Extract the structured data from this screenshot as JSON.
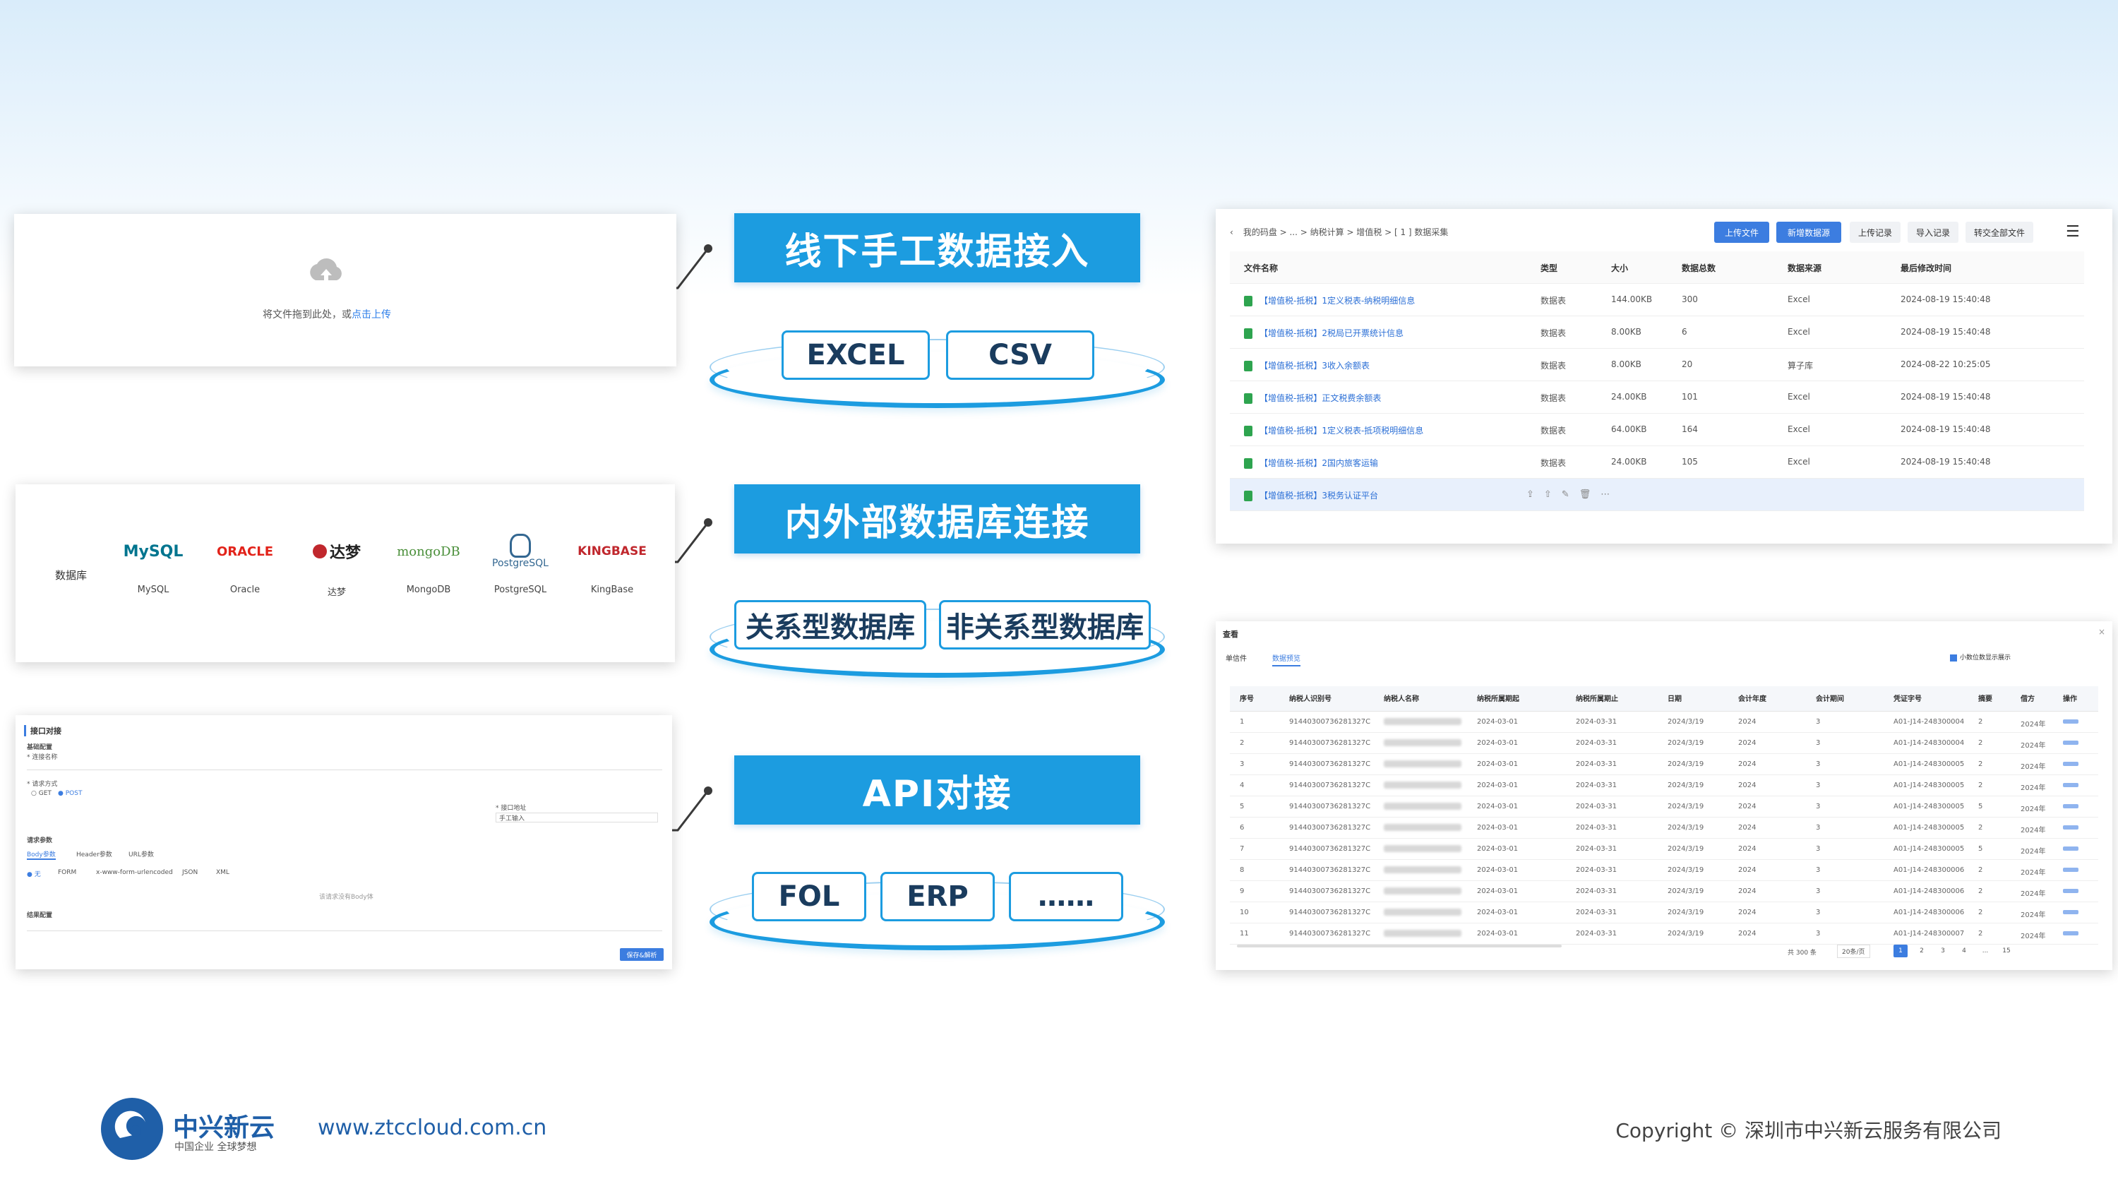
{
  "categories": [
    {
      "title": "线下手工数据接入",
      "tags": [
        "EXCEL",
        "CSV"
      ]
    },
    {
      "title": "内外部数据库连接",
      "tags": [
        "关系型数据库",
        "非关系型数据库"
      ]
    },
    {
      "title": "API对接",
      "tags": [
        "FOL",
        "ERP",
        "……"
      ]
    }
  ],
  "upload_panel": {
    "text": "将文件拖到此处，或",
    "link": "点击上传"
  },
  "db_panel": {
    "label": "数据库",
    "databases": [
      {
        "logo": "MySQL",
        "caption": "MySQL"
      },
      {
        "logo": "ORACLE",
        "caption": "Oracle"
      },
      {
        "logo": "达梦",
        "caption": "达梦"
      },
      {
        "logo": "mongoDB",
        "caption": "MongoDB"
      },
      {
        "logo": "PostgreSQL",
        "caption": "PostgreSQL"
      },
      {
        "logo": "KINGBASE",
        "caption": "KingBase"
      }
    ]
  },
  "api_panel": {
    "title": "接口对接",
    "section_basic": "基础配置",
    "url_label": "* 连接名称",
    "method_label": "* 请求方式",
    "methods": [
      "GET",
      "POST"
    ],
    "api_url_label": "* 接口地址",
    "api_url_placeholder": "手工输入",
    "params_title": "请求参数",
    "param_tabs": [
      "Body参数",
      "Header参数",
      "URL参数"
    ],
    "body_types": [
      "无",
      "FORM",
      "x-www-form-urlencoded",
      "JSON",
      "XML"
    ],
    "no_body_hint": "该请求没有Body体",
    "result_title": "结果配置",
    "submit_label": "保存&解析"
  },
  "file_panel": {
    "breadcrumb": "我的码盘 > ... > 纳税计算 > 增值税 > [ 1 ] 数据采集",
    "buttons": [
      "上传文件",
      "新增数据源",
      "上传记录",
      "导入记录",
      "转交全部文件"
    ],
    "columns": [
      "文件名称",
      "类型",
      "大小",
      "数据总数",
      "数据来源",
      "最后修改时间"
    ],
    "rows": [
      {
        "name": "【增值税-抵税】1定义税表-纳税明细信息",
        "type": "数据表",
        "size": "144.00KB",
        "count": "300",
        "source": "Excel",
        "time": "2024-08-19 15:40:48"
      },
      {
        "name": "【增值税-抵税】2税局已开票统计信息",
        "type": "数据表",
        "size": "8.00KB",
        "count": "6",
        "source": "Excel",
        "time": "2024-08-19 15:40:48"
      },
      {
        "name": "【增值税-抵税】3收入余额表",
        "type": "数据表",
        "size": "8.00KB",
        "count": "20",
        "source": "算子库",
        "time": "2024-08-22 10:25:05"
      },
      {
        "name": "【增值税-抵税】正文税费余额表",
        "type": "数据表",
        "size": "24.00KB",
        "count": "101",
        "source": "Excel",
        "time": "2024-08-19 15:40:48"
      },
      {
        "name": "【增值税-抵税】1定义税表-抵项税明细信息",
        "type": "数据表",
        "size": "64.00KB",
        "count": "164",
        "source": "Excel",
        "time": "2024-08-19 15:40:48"
      },
      {
        "name": "【增值税-抵税】2国内旅客运输",
        "type": "数据表",
        "size": "24.00KB",
        "count": "105",
        "source": "Excel",
        "time": "2024-08-19 15:40:48"
      },
      {
        "name": "【增值税-抵税】3税务认证平台",
        "type": "",
        "size": "",
        "count": "",
        "source": "",
        "time": ""
      }
    ]
  },
  "grid_panel": {
    "title": "查看",
    "tabs": [
      "单信件",
      "数据预览"
    ],
    "checkbox_label": "小数位数显示展示",
    "columns": [
      "序号",
      "纳税人识别号",
      "纳税人名称",
      "纳税所属期起",
      "纳税所属期止",
      "日期",
      "会计年度",
      "会计期间",
      "凭证字号",
      "摘要",
      "借方",
      "操作"
    ],
    "rows": [
      {
        "idx": "1",
        "tax_id": "91440300736281327C",
        "start": "2024-03-01",
        "end": "2024-03-31",
        "date": "2024/3/19",
        "year": "2024",
        "period": "3",
        "voucher": "A01-J14-248300004",
        "sum": "2",
        "debit": "2024年"
      },
      {
        "idx": "2",
        "tax_id": "91440300736281327C",
        "start": "2024-03-01",
        "end": "2024-03-31",
        "date": "2024/3/19",
        "year": "2024",
        "period": "3",
        "voucher": "A01-J14-248300004",
        "sum": "2",
        "debit": "2024年"
      },
      {
        "idx": "3",
        "tax_id": "91440300736281327C",
        "start": "2024-03-01",
        "end": "2024-03-31",
        "date": "2024/3/19",
        "year": "2024",
        "period": "3",
        "voucher": "A01-J14-248300005",
        "sum": "2",
        "debit": "2024年"
      },
      {
        "idx": "4",
        "tax_id": "91440300736281327C",
        "start": "2024-03-01",
        "end": "2024-03-31",
        "date": "2024/3/19",
        "year": "2024",
        "period": "3",
        "voucher": "A01-J14-248300005",
        "sum": "2",
        "debit": "2024年"
      },
      {
        "idx": "5",
        "tax_id": "91440300736281327C",
        "start": "2024-03-01",
        "end": "2024-03-31",
        "date": "2024/3/19",
        "year": "2024",
        "period": "3",
        "voucher": "A01-J14-248300005",
        "sum": "5",
        "debit": "2024年"
      },
      {
        "idx": "6",
        "tax_id": "91440300736281327C",
        "start": "2024-03-01",
        "end": "2024-03-31",
        "date": "2024/3/19",
        "year": "2024",
        "period": "3",
        "voucher": "A01-J14-248300005",
        "sum": "2",
        "debit": "2024年"
      },
      {
        "idx": "7",
        "tax_id": "91440300736281327C",
        "start": "2024-03-01",
        "end": "2024-03-31",
        "date": "2024/3/19",
        "year": "2024",
        "period": "3",
        "voucher": "A01-J14-248300005",
        "sum": "5",
        "debit": "2024年"
      },
      {
        "idx": "8",
        "tax_id": "91440300736281327C",
        "start": "2024-03-01",
        "end": "2024-03-31",
        "date": "2024/3/19",
        "year": "2024",
        "period": "3",
        "voucher": "A01-J14-248300006",
        "sum": "2",
        "debit": "2024年"
      },
      {
        "idx": "9",
        "tax_id": "91440300736281327C",
        "start": "2024-03-01",
        "end": "2024-03-31",
        "date": "2024/3/19",
        "year": "2024",
        "period": "3",
        "voucher": "A01-J14-248300006",
        "sum": "2",
        "debit": "2024年"
      },
      {
        "idx": "10",
        "tax_id": "91440300736281327C",
        "start": "2024-03-01",
        "end": "2024-03-31",
        "date": "2024/3/19",
        "year": "2024",
        "period": "3",
        "voucher": "A01-J14-248300006",
        "sum": "2",
        "debit": "2024年"
      },
      {
        "idx": "11",
        "tax_id": "91440300736281327C",
        "start": "2024-03-01",
        "end": "2024-03-31",
        "date": "2024/3/19",
        "year": "2024",
        "period": "3",
        "voucher": "A01-J14-248300007",
        "sum": "2",
        "debit": "2024年"
      }
    ],
    "total_label": "共 300 条",
    "page_size": "20条/页",
    "pages": [
      "1",
      "2",
      "3",
      "4",
      "...",
      "15"
    ]
  },
  "footer": {
    "brand": "中兴新云",
    "slogan": "中国企业 全球梦想",
    "url": "www.ztccloud.com.cn",
    "copyright": "Copyright © 深圳市中兴新云服务有限公司"
  },
  "colors": {
    "accent": "#1c9ce0",
    "link": "#2b7de9",
    "brand": "#1f5fa8"
  }
}
